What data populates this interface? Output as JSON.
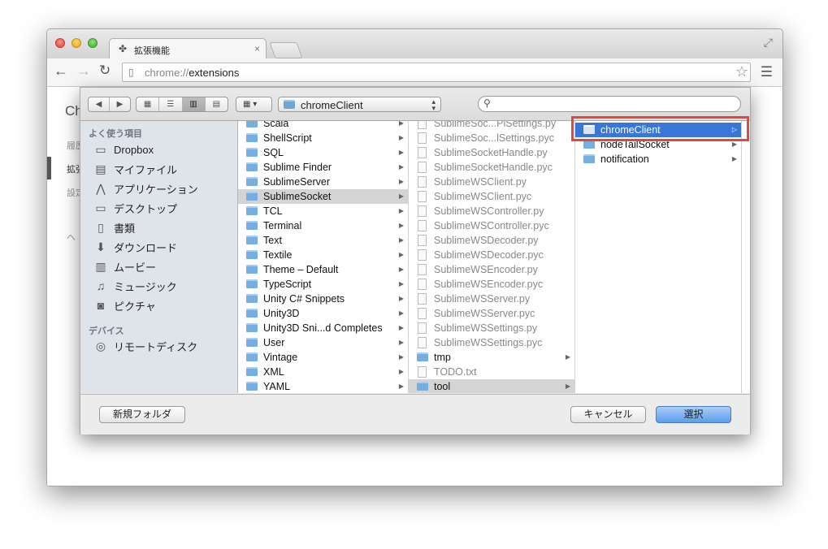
{
  "browser": {
    "tab_title": "拡張機能",
    "tab_close": "×",
    "url_scheme": "chrome://",
    "url_path": "extensions"
  },
  "page_background": {
    "title": "Ch",
    "nav_items": [
      "履歴",
      "拡張",
      "設定",
      "ヘ"
    ]
  },
  "dialog": {
    "path_label": "chromeClient",
    "sidebar": {
      "favorites_heading": "よく使う項目",
      "favorites": [
        {
          "label": "Dropbox",
          "icon": "folder-icon"
        },
        {
          "label": "マイファイル",
          "icon": "all-files-icon"
        },
        {
          "label": "アプリケーション",
          "icon": "applications-icon"
        },
        {
          "label": "デスクトップ",
          "icon": "desktop-icon"
        },
        {
          "label": "書類",
          "icon": "documents-icon"
        },
        {
          "label": "ダウンロード",
          "icon": "downloads-icon"
        },
        {
          "label": "ムービー",
          "icon": "movies-icon"
        },
        {
          "label": "ミュージック",
          "icon": "music-icon"
        },
        {
          "label": "ピクチャ",
          "icon": "pictures-icon"
        }
      ],
      "devices_heading": "デバイス",
      "devices": [
        {
          "label": "リモートディスク",
          "icon": "remote-disc-icon"
        }
      ]
    },
    "column1": [
      "Scala",
      "ShellScript",
      "SQL",
      "Sublime Finder",
      "SublimeServer",
      "SublimeSocket",
      "TCL",
      "Terminal",
      "Text",
      "Textile",
      "Theme – Default",
      "TypeScript",
      "Unity C# Snippets",
      "Unity3D",
      "Unity3D Sni...d Completes",
      "User",
      "Vintage",
      "XML",
      "YAML"
    ],
    "column2": [
      {
        "name": "SublimeSoc...PlSettings.py",
        "kind": "file"
      },
      {
        "name": "SublimeSoc...lSettings.pyc",
        "kind": "file"
      },
      {
        "name": "SublimeSocketHandle.py",
        "kind": "file"
      },
      {
        "name": "SublimeSocketHandle.pyc",
        "kind": "file"
      },
      {
        "name": "SublimeWSClient.py",
        "kind": "file"
      },
      {
        "name": "SublimeWSClient.pyc",
        "kind": "file"
      },
      {
        "name": "SublimeWSController.py",
        "kind": "file"
      },
      {
        "name": "SublimeWSController.pyc",
        "kind": "file"
      },
      {
        "name": "SublimeWSDecoder.py",
        "kind": "file"
      },
      {
        "name": "SublimeWSDecoder.pyc",
        "kind": "file"
      },
      {
        "name": "SublimeWSEncoder.py",
        "kind": "file"
      },
      {
        "name": "SublimeWSEncoder.pyc",
        "kind": "file"
      },
      {
        "name": "SublimeWSServer.py",
        "kind": "file"
      },
      {
        "name": "SublimeWSServer.pyc",
        "kind": "file"
      },
      {
        "name": "SublimeWSSettings.py",
        "kind": "file"
      },
      {
        "name": "SublimeWSSettings.pyc",
        "kind": "file"
      },
      {
        "name": "tmp",
        "kind": "folder"
      },
      {
        "name": "TODO.txt",
        "kind": "file"
      },
      {
        "name": "tool",
        "kind": "folder"
      }
    ],
    "column3": [
      "chromeClient",
      "nodeTailSocket",
      "notification"
    ],
    "buttons": {
      "new_folder": "新規フォルダ",
      "cancel": "キャンセル",
      "select": "選択"
    }
  },
  "colors": {
    "selection_blue": "#3876d8",
    "callout_red": "#e2473b"
  }
}
